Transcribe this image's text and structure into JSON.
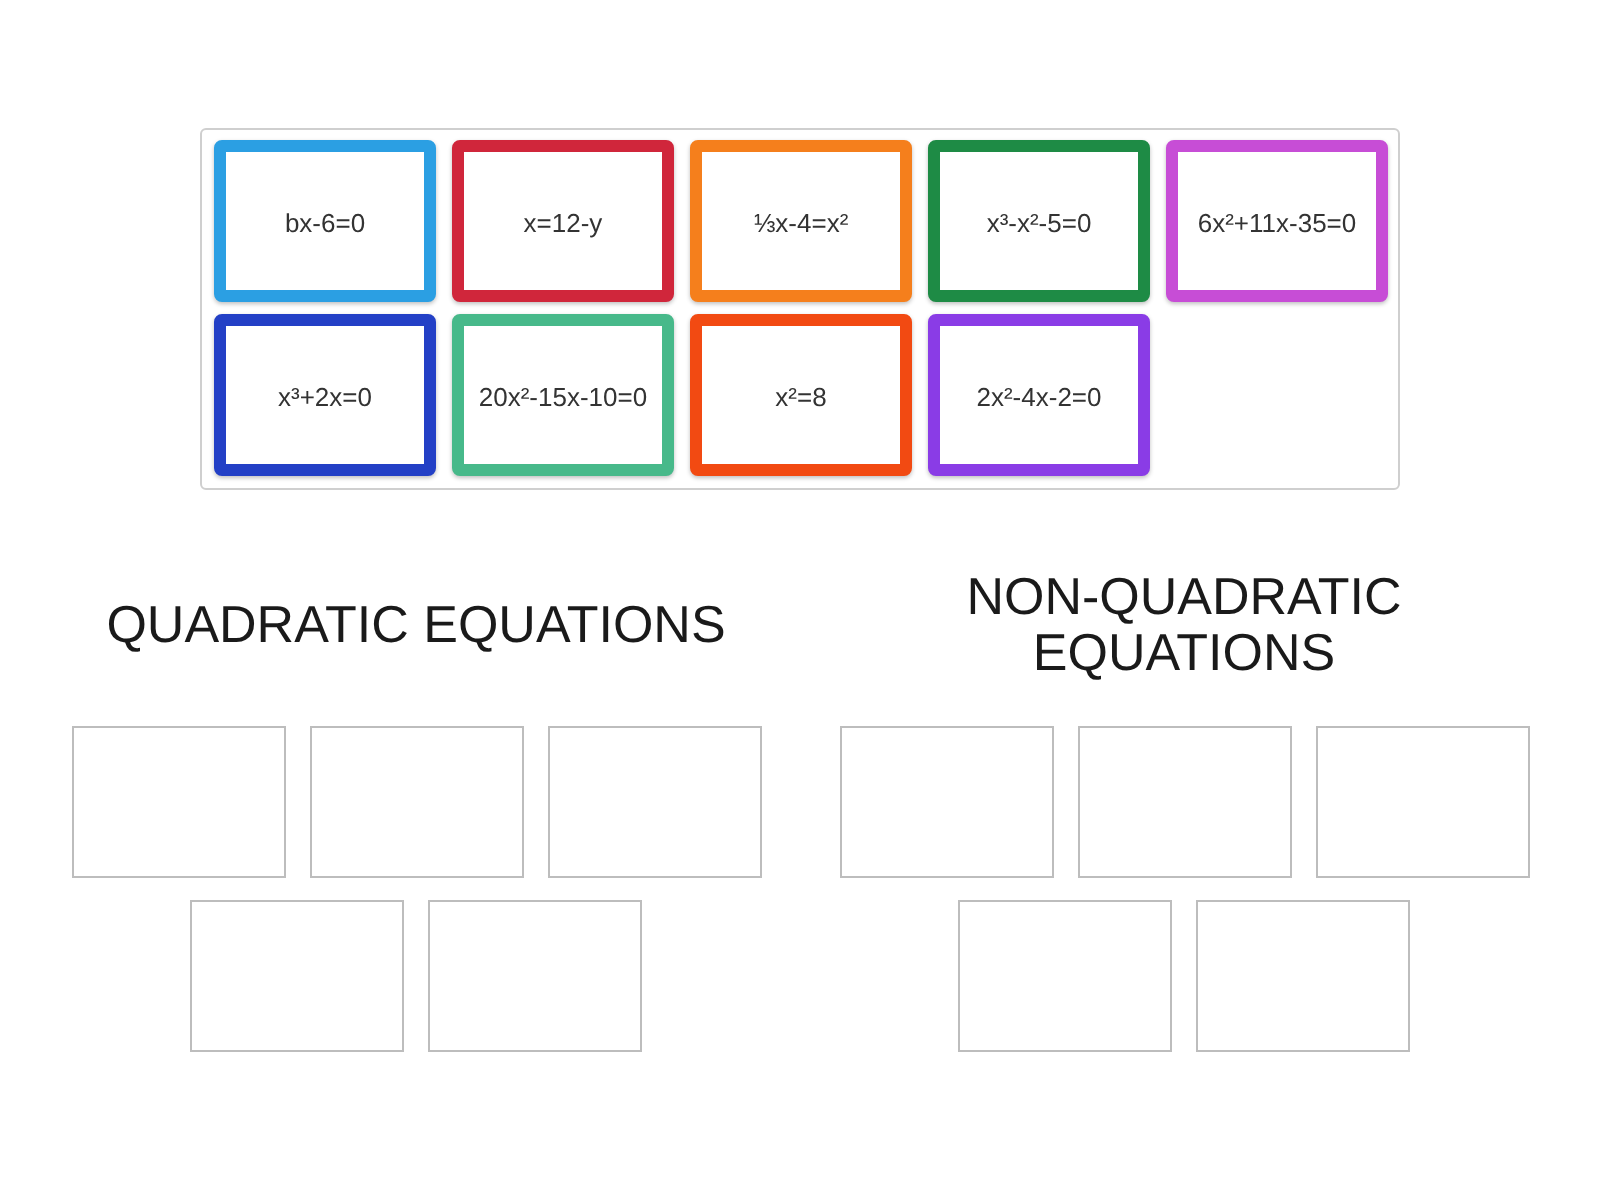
{
  "cards": [
    {
      "text": "bx-6=0",
      "color": "#2b9fe3"
    },
    {
      "text": "x=12-y",
      "color": "#d0263b"
    },
    {
      "text": "⅓x-4=x²",
      "color": "#f57f1c"
    },
    {
      "text": "x³-x²-5=0",
      "color": "#1e8b45"
    },
    {
      "text": "6x²+11x-35=0",
      "color": "#c74dd6"
    },
    {
      "text": "x³+2x=0",
      "color": "#2340c6"
    },
    {
      "text": "20x²-15x-10=0",
      "color": "#47b98a"
    },
    {
      "text": "x²=8",
      "color": "#f24a12"
    },
    {
      "text": "2x²-4x-2=0",
      "color": "#8a3ce6"
    }
  ],
  "groups": [
    {
      "title": "QUADRATIC EQUATIONS",
      "slots": [
        {
          "kind": "empty"
        },
        {
          "kind": "empty"
        },
        {
          "kind": "empty"
        },
        {
          "kind": "empty"
        },
        {
          "kind": "empty"
        }
      ]
    },
    {
      "title": "NON-QUADRATIC EQUATIONS",
      "slots": [
        {
          "kind": "empty"
        },
        {
          "kind": "empty"
        },
        {
          "kind": "empty"
        },
        {
          "kind": "empty"
        },
        {
          "kind": "empty"
        }
      ]
    }
  ]
}
